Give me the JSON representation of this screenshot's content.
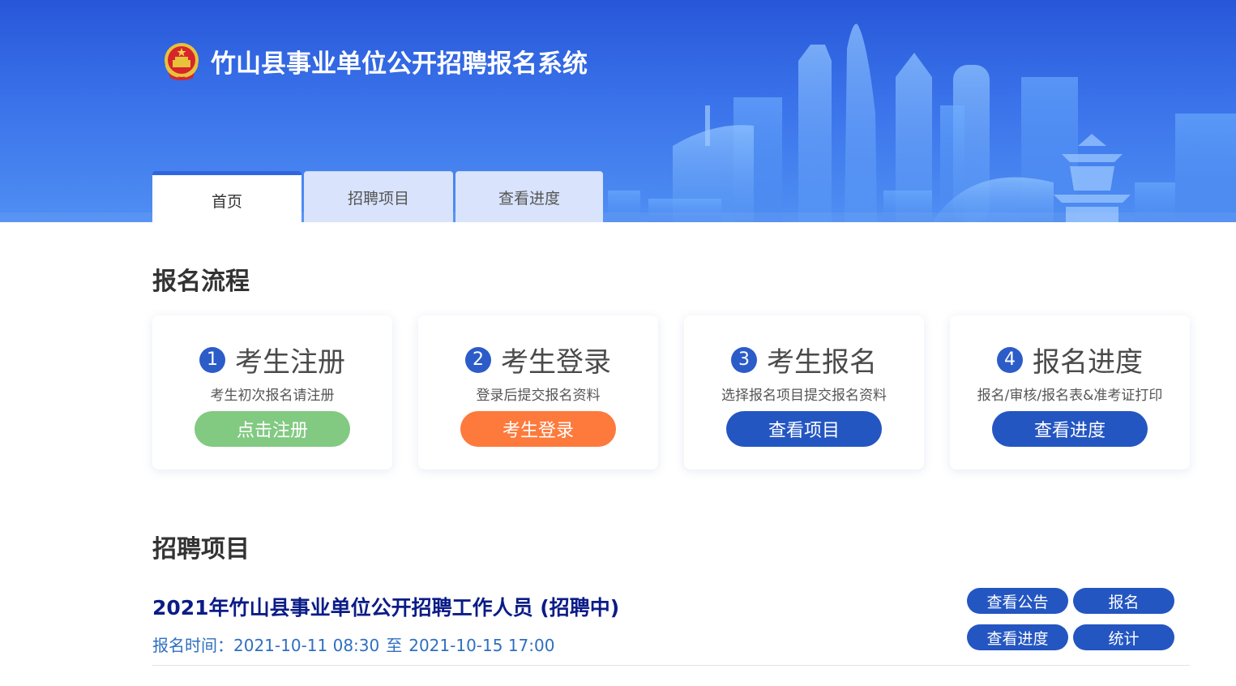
{
  "header": {
    "site_title": "竹山县事业单位公开招聘报名系统"
  },
  "nav": {
    "tabs": [
      {
        "label": "首页",
        "active": true
      },
      {
        "label": "招聘项目",
        "active": false
      },
      {
        "label": "查看进度",
        "active": false
      }
    ]
  },
  "process": {
    "title": "报名流程",
    "steps": [
      {
        "number": "1",
        "title": "考生注册",
        "desc": "考生初次报名请注册",
        "button": "点击注册",
        "color": "#82c982"
      },
      {
        "number": "2",
        "title": "考生登录",
        "desc": "登录后提交报名资料",
        "button": "考生登录",
        "color": "#fd7a3c"
      },
      {
        "number": "3",
        "title": "考生报名",
        "desc": "选择报名项目提交报名资料",
        "button": "查看项目",
        "color": "#2456c2"
      },
      {
        "number": "4",
        "title": "报名进度",
        "desc": "报名/审核/报名表&准考证打印",
        "button": "查看进度",
        "color": "#2456c2"
      }
    ]
  },
  "projects": {
    "title": "招聘项目",
    "items": [
      {
        "title": "2021年竹山县事业单位公开招聘工作人员 (招聘中)",
        "time_label": "报名时间：",
        "start": "2021-10-11 08:30",
        "sep": "至",
        "end": "2021-10-15 17:00",
        "actions": {
          "notice": "查看公告",
          "apply": "报名",
          "progress": "查看进度",
          "stats": "统计"
        }
      }
    ]
  },
  "colors": {
    "header_top": "#2757d8",
    "header_bottom": "#4f8ff3",
    "primary": "#2456c2",
    "project_title": "#0b1c87",
    "project_time": "#2f6fc0"
  },
  "icons": {
    "emblem": "national-emblem-icon"
  }
}
